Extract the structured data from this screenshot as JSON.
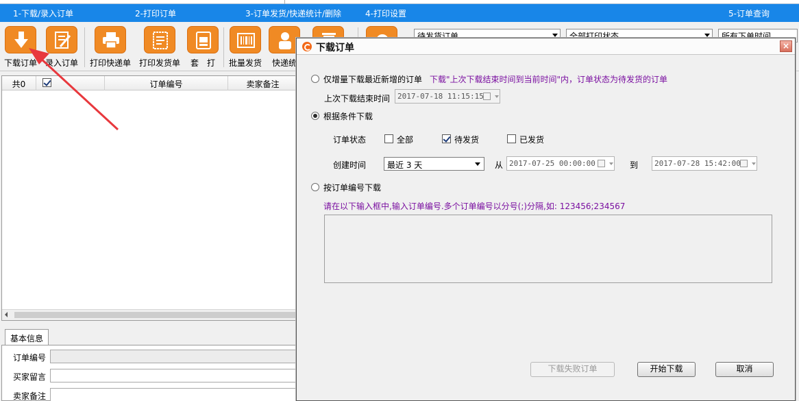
{
  "tabs": [
    {
      "label": "1-下载/录入订单"
    },
    {
      "label": "2-打印订单"
    },
    {
      "label": "3-订单发货/快递统计/删除"
    },
    {
      "label": "4-打印设置"
    },
    {
      "label": "5-订单查询"
    }
  ],
  "toolbar": {
    "tools": [
      {
        "label": "下载订单",
        "icon": "download-icon"
      },
      {
        "label": "录入订单",
        "icon": "edit-form-icon"
      },
      {
        "label": "打印快递单",
        "icon": "printer-icon"
      },
      {
        "label": "打印发货单",
        "icon": "receipt-icon"
      },
      {
        "label": "套　打",
        "icon": "print-template-icon"
      },
      {
        "label": "批量发货",
        "icon": "barcode-icon"
      },
      {
        "label": "快递统",
        "icon": "courier-icon"
      },
      {
        "label": "",
        "icon": "delete-icon"
      },
      {
        "label": "",
        "icon": "settings-icon"
      }
    ],
    "filters": [
      {
        "value": "待发货订单"
      },
      {
        "value": "全部打印状态"
      },
      {
        "value": "所有下单时间"
      }
    ]
  },
  "grid": {
    "count_label": "共0",
    "columns": [
      "订单编号",
      "卖家备注"
    ]
  },
  "info": {
    "tab_label": "基本信息",
    "fields": [
      {
        "label": "订单编号"
      },
      {
        "label": "买家留言"
      },
      {
        "label": "卖家备注"
      }
    ]
  },
  "dialog": {
    "title": "下载订单",
    "close_glyph": "×",
    "option1": {
      "label": "仅增量下载最近新增的订单",
      "hint": "下载\"上次下载结束时间到当前时间\"内，订单状态为待发货的订单",
      "last_end_label": "上次下载结束时间",
      "last_end_value": "2017-07-18 11:15:15"
    },
    "option2": {
      "label": "根据条件下载",
      "status_label": "订单状态",
      "status_all": "全部",
      "status_pending": "待发货",
      "status_shipped": "已发货",
      "created_label": "创建时间",
      "range_value": "最近 3 天",
      "from_label": "从",
      "from_value": "2017-07-25 00:00:00",
      "to_label": "到",
      "to_value": "2017-07-28 15:42:00"
    },
    "option3": {
      "label": "按订单编号下载",
      "hint": "请在以下输入框中,输入订单编号.多个订单编号以分号(;)分隔,如: 123456;234567"
    },
    "buttons": {
      "failed": "下载失败订单",
      "start": "开始下载",
      "cancel": "取消"
    }
  },
  "colors": {
    "tab_bar": "#1886e8",
    "tool_orange": "#f08a24",
    "hint_purple": "#7a0fa0",
    "annotation_red": "#e8383d"
  }
}
